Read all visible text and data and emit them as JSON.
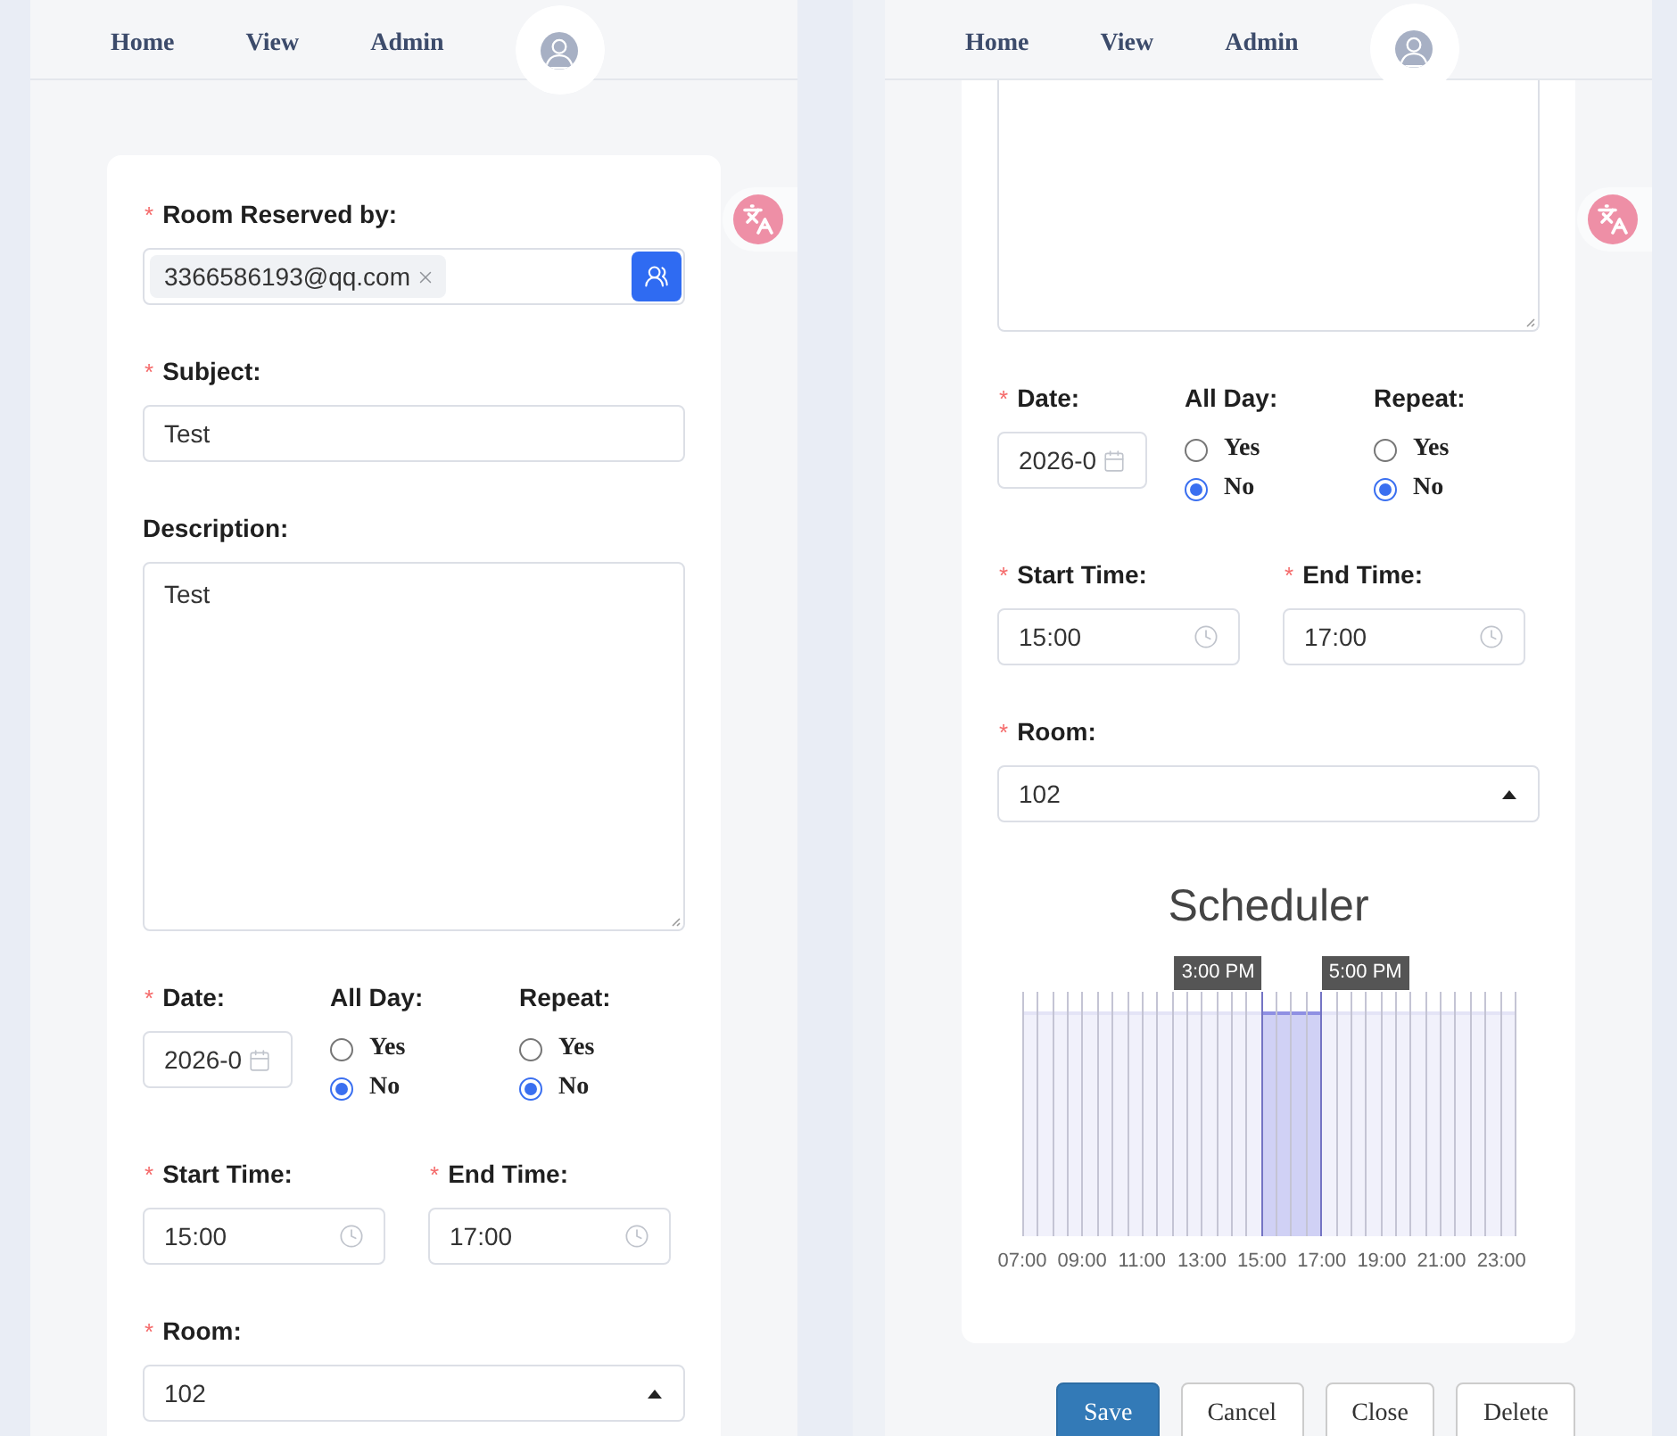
{
  "screens": [
    {
      "nav": [
        "Home",
        "View",
        "Admin"
      ],
      "form": {
        "rows": [
          {
            "fields": [
              {
                "kind": "tags",
                "required_mark": "*",
                "label": "Room Reserved by:",
                "tags": [
                  "3366586193@qq.com"
                ]
              }
            ]
          },
          {
            "fields": [
              {
                "kind": "text",
                "required_mark": "*",
                "label": "Subject:",
                "value": "Test"
              }
            ]
          },
          {
            "fields": [
              {
                "kind": "textarea",
                "label": "Description:",
                "value": "Test"
              }
            ]
          },
          {
            "fields": [
              {
                "kind": "date",
                "required_mark": "*",
                "label": "Date:",
                "value": "2026-0"
              },
              {
                "kind": "radio",
                "label": "All Day:",
                "options": [
                  {
                    "label": "Yes",
                    "selected": false
                  },
                  {
                    "label": "No",
                    "selected": true
                  }
                ]
              },
              {
                "kind": "radio",
                "label": "Repeat:",
                "options": [
                  {
                    "label": "Yes",
                    "selected": false
                  },
                  {
                    "label": "No",
                    "selected": true
                  }
                ]
              }
            ]
          },
          {
            "fields": [
              {
                "kind": "time",
                "required_mark": "*",
                "label": "Start Time:",
                "value": "15:00"
              },
              {
                "kind": "time",
                "required_mark": "*",
                "label": "End Time:",
                "value": "17:00"
              }
            ]
          },
          {
            "fields": [
              {
                "kind": "select",
                "required_mark": "*",
                "label": "Room:",
                "value": "102"
              }
            ]
          }
        ]
      }
    },
    {
      "nav": [
        "Home",
        "View",
        "Admin"
      ],
      "form": {
        "rows": [
          {
            "fields": [
              {
                "kind": "textarea_tail"
              }
            ]
          },
          {
            "fields": [
              {
                "kind": "date",
                "required_mark": "*",
                "label": "Date:",
                "value": "2026-0"
              },
              {
                "kind": "radio",
                "label": "All Day:",
                "options": [
                  {
                    "label": "Yes",
                    "selected": false
                  },
                  {
                    "label": "No",
                    "selected": true
                  }
                ]
              },
              {
                "kind": "radio",
                "label": "Repeat:",
                "options": [
                  {
                    "label": "Yes",
                    "selected": false
                  },
                  {
                    "label": "No",
                    "selected": true
                  }
                ]
              }
            ]
          },
          {
            "fields": [
              {
                "kind": "time",
                "required_mark": "*",
                "label": "Start Time:",
                "value": "15:00"
              },
              {
                "kind": "time",
                "required_mark": "*",
                "label": "End Time:",
                "value": "17:00"
              }
            ]
          },
          {
            "fields": [
              {
                "kind": "select",
                "required_mark": "*",
                "label": "Room:",
                "value": "102"
              }
            ]
          }
        ]
      },
      "scheduler": {
        "title": "Scheduler",
        "start_tooltip": "3:00 PM",
        "end_tooltip": "5:00 PM",
        "slots": [
          {
            "selected": false
          },
          {
            "selected": false
          },
          {
            "selected": false
          },
          {
            "selected": false
          },
          {
            "selected": false
          },
          {
            "selected": false
          },
          {
            "selected": false
          },
          {
            "selected": false
          },
          {
            "selected": false
          },
          {
            "selected": false
          },
          {
            "selected": false
          },
          {
            "selected": false
          },
          {
            "selected": false
          },
          {
            "selected": false
          },
          {
            "selected": false
          },
          {
            "selected": false
          },
          {
            "selected": true
          },
          {
            "selected": true
          },
          {
            "selected": true
          },
          {
            "selected": true
          },
          {
            "selected": false
          },
          {
            "selected": false
          },
          {
            "selected": false
          },
          {
            "selected": false
          },
          {
            "selected": false
          },
          {
            "selected": false
          },
          {
            "selected": false
          },
          {
            "selected": false
          },
          {
            "selected": false
          },
          {
            "selected": false
          },
          {
            "selected": false
          },
          {
            "selected": false
          },
          {
            "selected": false
          }
        ],
        "axis_labels": [
          "07:00",
          "09:00",
          "11:00",
          "13:00",
          "15:00",
          "17:00",
          "19:00",
          "21:00",
          "23:00"
        ]
      },
      "buttons": [
        {
          "kind": "primary",
          "label": "Save"
        },
        {
          "kind": "default",
          "label": "Cancel"
        },
        {
          "kind": "default",
          "label": "Close"
        },
        {
          "kind": "default",
          "label": "Delete"
        }
      ]
    }
  ]
}
